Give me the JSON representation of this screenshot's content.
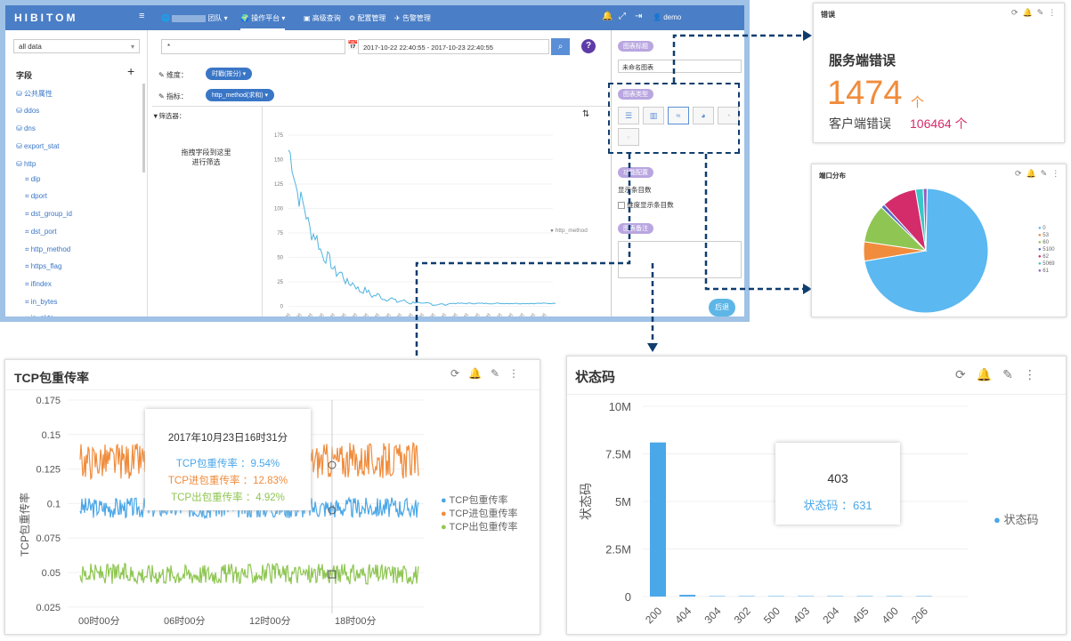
{
  "app": {
    "logo": "HIBITOM",
    "user": "demo",
    "team": "团队",
    "nav": [
      {
        "label": "操作平台"
      },
      {
        "label": "高级查询"
      },
      {
        "label": "配置管理"
      },
      {
        "label": "告警管理"
      }
    ]
  },
  "toolbar": {
    "dataset": "all data",
    "query": "*",
    "time_range": "2017-10-22 22:40:55 - 2017-10-23 22:40:55"
  },
  "sidebar": {
    "title": "字段",
    "top_items": [
      "公共属性",
      "ddos",
      "dns",
      "export_stat",
      "http"
    ],
    "sub_items": [
      "dip",
      "dport",
      "dst_group_id",
      "dst_port",
      "http_method",
      "https_flag",
      "ifindex",
      "in_bytes",
      "in_pkts"
    ]
  },
  "builder": {
    "dimension_label": "维度：",
    "dimension_value": "时戳(按分)",
    "metric_label": "指标：",
    "metric_value": "http_method(求和)",
    "filter_label": "筛选器：",
    "drop_hint_1": "拖拽字段到这里",
    "drop_hint_2": "进行筛选",
    "legend": "http_method",
    "y_ticks": [
      "175",
      "150",
      "125",
      "100",
      "75",
      "50",
      "25",
      "0"
    ]
  },
  "rpanel": {
    "title_label": "图表标题",
    "title_value": "未命名图表",
    "type_label": "图表类型",
    "func_label": "功能配置",
    "show_count": "显示条目数",
    "dim_count": "维度显示条目数",
    "note_label": "图表备注",
    "back": "后退"
  },
  "err_card": {
    "title": "错误",
    "heading": "服务端错误",
    "server_count": "1474",
    "server_unit": "个",
    "client_label": "客户端错误",
    "client_count": "106464 个"
  },
  "port_card": {
    "title": "端口分布",
    "legend": [
      "0",
      "53",
      "60",
      "5100",
      "62",
      "5069",
      "61"
    ],
    "colors": [
      "#5bb8f0",
      "#f08c3c",
      "#8fc653",
      "#5a67c4",
      "#d42c6a",
      "#3ac7c7",
      "#8e5fc4"
    ],
    "values": [
      72,
      5,
      10,
      1,
      9,
      2,
      1
    ]
  },
  "tcp_card": {
    "title": "TCP包重传率",
    "ylabel": "TCP包重传率",
    "tooltip_time": "2017年10月23日16时31分",
    "tooltip_rows": [
      {
        "label": "TCP包重传率",
        "value": "9.54%",
        "color": "#4aa7e8"
      },
      {
        "label": "TCP进包重传率",
        "value": "12.83%",
        "color": "#f08c3c"
      },
      {
        "label": "TCP出包重传率",
        "value": "4.92%",
        "color": "#8fc653"
      }
    ],
    "legend": [
      "TCP包重传率",
      "TCP进包重传率",
      "TCP出包重传率"
    ],
    "y_ticks": [
      "0.175",
      "0.15",
      "0.125",
      "0.1",
      "0.075",
      "0.05",
      "0.025"
    ],
    "x_ticks": [
      "00时00分",
      "06时00分",
      "12时00分",
      "18时00分"
    ]
  },
  "status_card": {
    "title": "状态码",
    "ylabel": "状态码",
    "legend": "状态码",
    "tooltip_code": "403",
    "tooltip_label": "状态码",
    "tooltip_value": "631",
    "y_ticks": [
      "10M",
      "7.5M",
      "5M",
      "2.5M",
      "0"
    ]
  },
  "chart_data": [
    {
      "type": "line",
      "title": "TCP包重传率",
      "ylabel": "TCP包重传率",
      "ylim": [
        0.025,
        0.175
      ],
      "x": [
        "00时00分",
        "06时00分",
        "12时00分",
        "18时00分"
      ],
      "series": [
        {
          "name": "TCP包重传率",
          "approx_level": 0.0954
        },
        {
          "name": "TCP进包重传率",
          "approx_level": 0.1283
        },
        {
          "name": "TCP出包重传率",
          "approx_level": 0.0492
        }
      ]
    },
    {
      "type": "bar",
      "title": "状态码",
      "ylabel": "状态码",
      "ylim": [
        0,
        10000000
      ],
      "categories": [
        "200",
        "404",
        "304",
        "302",
        "500",
        "403",
        "204",
        "405",
        "400",
        "206"
      ],
      "values": [
        8100000,
        90000,
        2000,
        1500,
        1200,
        631,
        500,
        300,
        200,
        100
      ]
    },
    {
      "type": "pie",
      "title": "端口分布",
      "categories": [
        "0",
        "53",
        "60",
        "5100",
        "62",
        "5069",
        "61"
      ],
      "values": [
        72,
        5,
        10,
        1,
        9,
        2,
        1
      ]
    }
  ]
}
